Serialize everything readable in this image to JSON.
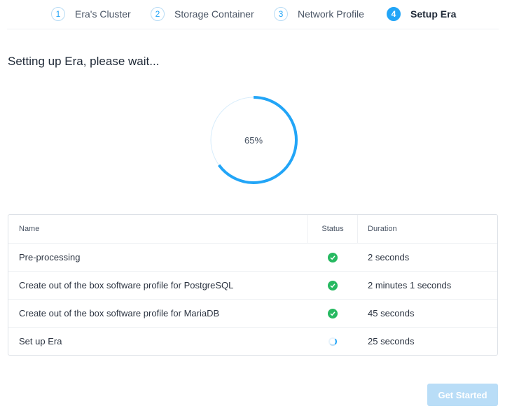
{
  "wizard": {
    "steps": [
      {
        "number": "1",
        "label": "Era's Cluster",
        "active": false
      },
      {
        "number": "2",
        "label": "Storage Container",
        "active": false
      },
      {
        "number": "3",
        "label": "Network Profile",
        "active": false
      },
      {
        "number": "4",
        "label": "Setup Era",
        "active": true
      }
    ]
  },
  "main": {
    "title": "Setting up Era, please wait...",
    "progress": {
      "value": 65,
      "label": "65%"
    }
  },
  "table": {
    "headers": {
      "name": "Name",
      "status": "Status",
      "duration": "Duration"
    },
    "rows": [
      {
        "name": "Pre-processing",
        "status": "completed",
        "status_icon": "check-circle-icon",
        "duration": "2 seconds"
      },
      {
        "name": "Create out of the box software profile for PostgreSQL",
        "status": "completed",
        "status_icon": "check-circle-icon",
        "duration": "2 minutes 1 seconds"
      },
      {
        "name": "Create out of the box software profile for MariaDB",
        "status": "completed",
        "status_icon": "check-circle-icon",
        "duration": "45 seconds"
      },
      {
        "name": "Set up Era",
        "status": "in-progress",
        "status_icon": "spinner-icon",
        "duration": "25 seconds"
      }
    ]
  },
  "footer": {
    "get_started_label": "Get Started"
  },
  "colors": {
    "accent": "#22a5f7",
    "success": "#27b961",
    "disabled_button": "#b9ddf7"
  }
}
